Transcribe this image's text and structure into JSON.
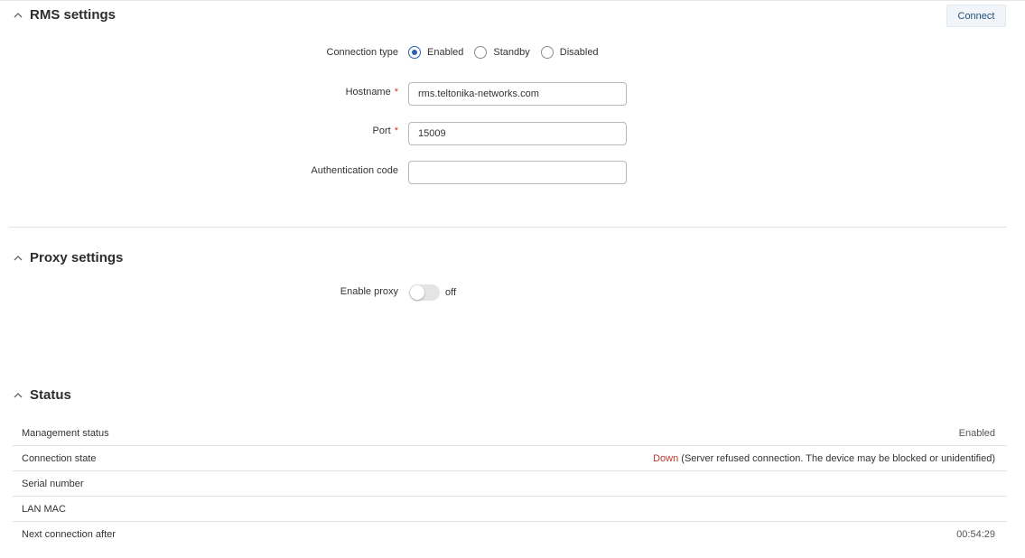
{
  "rms": {
    "title": "RMS settings",
    "connect_label": "Connect",
    "connection_type": {
      "label": "Connection type",
      "options": [
        "Enabled",
        "Standby",
        "Disabled"
      ],
      "selected": "Enabled"
    },
    "hostname": {
      "label": "Hostname",
      "required_mark": "*",
      "value": "rms.teltonika-networks.com"
    },
    "port": {
      "label": "Port",
      "required_mark": "*",
      "value": "15009"
    },
    "auth_code": {
      "label": "Authentication code",
      "value": ""
    }
  },
  "proxy": {
    "title": "Proxy settings",
    "enable_label": "Enable proxy",
    "enable_state": "off"
  },
  "status": {
    "title": "Status",
    "rows": [
      {
        "key": "Management status",
        "value": "Enabled"
      },
      {
        "key": "Connection state",
        "value_state": "Down",
        "value_detail": "(Server refused connection. The device may be blocked or unidentified)"
      },
      {
        "key": "Serial number",
        "value": ""
      },
      {
        "key": "LAN MAC",
        "value": ""
      },
      {
        "key": "Next connection after",
        "value": "00:54:29"
      }
    ]
  },
  "colors": {
    "accent": "#2a62ad",
    "down": "#c0392b",
    "button_bg": "#f1f5f9",
    "required": "#d0352b"
  },
  "icons": {
    "collapse": "chevron-up-icon"
  }
}
